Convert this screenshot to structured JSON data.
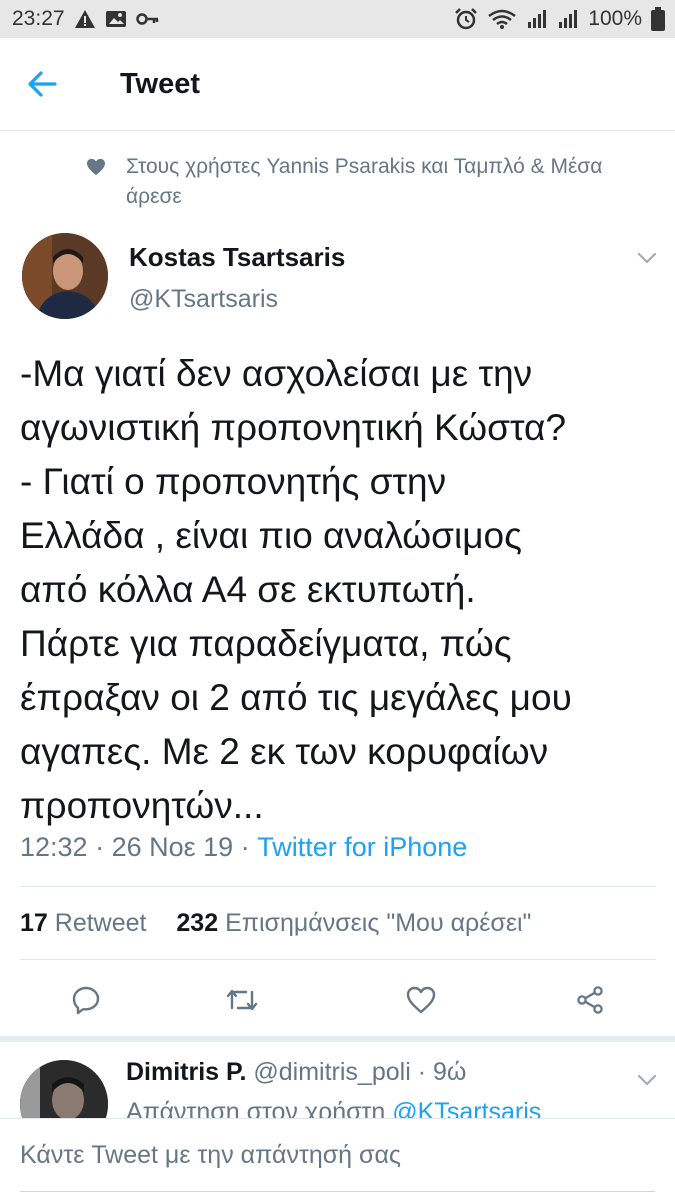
{
  "status_bar": {
    "time": "23:27",
    "battery": "100%"
  },
  "header": {
    "title": "Tweet"
  },
  "social_context": {
    "text": "Στους χρήστες Yannis Psarakis και Ταμπλό & Μέσα άρεσε"
  },
  "tweet": {
    "author_name": "Kostas Tsartsaris",
    "author_handle": "@KTsartsaris",
    "text_lines": [
      "-Μα γιατί δεν ασχολείσαι με την",
      "αγωνιστική προπονητική Κώστα?",
      "- Γιατί ο προπονητής στην",
      "Ελλάδα , είναι πιο αναλώσιμος",
      "από κόλλα Α4 σε εκτυπωτή.",
      "Πάρτε για παραδείγματα, πώς",
      "έπραξαν οι 2 από τις μεγάλες μου",
      "αγαπες. Με 2 εκ των κορυφαίων",
      "προπονητών..."
    ],
    "time": "12:32",
    "date": "26 Νοε 19",
    "source": "Twitter for iPhone",
    "separator": " · ",
    "retweet_count": "17",
    "retweet_label": "Retweet",
    "like_count": "232",
    "like_label": "Επισημάνσεις \"Μου αρέσει\""
  },
  "reply": {
    "name": "Dimitris P.",
    "handle": "@dimitris_poli",
    "age": "· 9ώ",
    "replying_to_label": "Απάντηση στον χρήστη ",
    "replying_to_handle": "@KTsartsaris"
  },
  "composer": {
    "placeholder": "Κάντε Tweet με την απάντησή σας"
  },
  "colors": {
    "accent": "#1da1f2",
    "secondary_text": "#657786",
    "divider": "#e1e8ed"
  }
}
